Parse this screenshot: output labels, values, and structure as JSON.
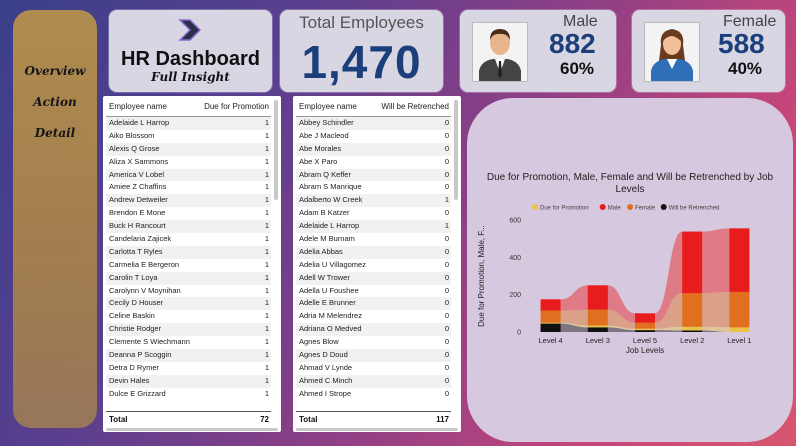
{
  "sidebar": {
    "items": [
      "Overview",
      "Action",
      "Detail"
    ]
  },
  "header": {
    "title": "HR Dashboard",
    "subtitle": "Full Insight"
  },
  "total": {
    "label": "Total Employees",
    "value": "1,470"
  },
  "male": {
    "label": "Male",
    "count": "882",
    "pct": "60%"
  },
  "female": {
    "label": "Female",
    "count": "588",
    "pct": "40%"
  },
  "table1": {
    "headers": [
      "Employee name",
      "Due for Promotion"
    ],
    "rows": [
      [
        "Adelaide L Harrop",
        "1"
      ],
      [
        "Aiko Blossom",
        "1"
      ],
      [
        "Alexis Q Grose",
        "1"
      ],
      [
        "Aliza X Sammons",
        "1"
      ],
      [
        "America V Lobel",
        "1"
      ],
      [
        "Amiee Z Chaffins",
        "1"
      ],
      [
        "Andrew Detweiler",
        "1"
      ],
      [
        "Brendon E Mone",
        "1"
      ],
      [
        "Buck H Rancourt",
        "1"
      ],
      [
        "Candelaria Zajicek",
        "1"
      ],
      [
        "Carlotta T Ryles",
        "1"
      ],
      [
        "Carmelia E Bergeron",
        "1"
      ],
      [
        "Carolin T Loya",
        "1"
      ],
      [
        "Carolynn V Moynihan",
        "1"
      ],
      [
        "Cecily D Houser",
        "1"
      ],
      [
        "Celine Baskin",
        "1"
      ],
      [
        "Christie Rodger",
        "1"
      ],
      [
        "Clemente S Wiechmann",
        "1"
      ],
      [
        "Deanna P Scoggin",
        "1"
      ],
      [
        "Detra D Rymer",
        "1"
      ],
      [
        "Devin Hales",
        "1"
      ],
      [
        "Dulce E Grizzard",
        "1"
      ]
    ],
    "total_label": "Total",
    "total_value": "72"
  },
  "table2": {
    "headers": [
      "Employee name",
      "Will be Retrenched"
    ],
    "rows": [
      [
        "Abbey Schindler",
        "0"
      ],
      [
        "Abe J Macleod",
        "0"
      ],
      [
        "Abe Morales",
        "0"
      ],
      [
        "Abe X Paro",
        "0"
      ],
      [
        "Abram Q Keffer",
        "0"
      ],
      [
        "Abram S Manrique",
        "0"
      ],
      [
        "Adalberto W Creek",
        "1"
      ],
      [
        "Adam B Katzer",
        "0"
      ],
      [
        "Adelaide L Harrop",
        "1"
      ],
      [
        "Adele M Burnam",
        "0"
      ],
      [
        "Adelia Abbas",
        "0"
      ],
      [
        "Adelia U Villagomez",
        "0"
      ],
      [
        "Adell W Trower",
        "0"
      ],
      [
        "Adella U Foushee",
        "0"
      ],
      [
        "Adelle E Brunner",
        "0"
      ],
      [
        "Adria M Melendrez",
        "0"
      ],
      [
        "Adriana O Medved",
        "0"
      ],
      [
        "Agnes Blow",
        "0"
      ],
      [
        "Agnes D Doud",
        "0"
      ],
      [
        "Ahmad V Lynde",
        "0"
      ],
      [
        "Ahmed C Minch",
        "0"
      ],
      [
        "Ahmed I Strope",
        "0"
      ]
    ],
    "total_label": "Total",
    "total_value": "117"
  },
  "chart_data": {
    "type": "area",
    "title": "Due for Promotion, Male, Female and Will be Retrenched by Job Levels",
    "xlabel": "Job Levels",
    "ylabel": "Due for Promotion, Male, F...",
    "categories": [
      "Level 4",
      "Level 3",
      "Level 5",
      "Level 2",
      "Level 1"
    ],
    "ylim": [
      0,
      600
    ],
    "yticks": [
      "0",
      "200",
      "400",
      "600"
    ],
    "series": [
      {
        "name": "Due for Promotion",
        "color": "#e8c24a",
        "values": [
          5,
          10,
          8,
          20,
          25
        ]
      },
      {
        "name": "Male",
        "color": "#e81c1c",
        "values": [
          60,
          130,
          50,
          330,
          340
        ]
      },
      {
        "name": "Female",
        "color": "#e07020",
        "values": [
          65,
          85,
          32,
          180,
          190
        ]
      },
      {
        "name": "Will be Retrenched",
        "color": "#111111",
        "values": [
          45,
          25,
          10,
          8,
          0
        ]
      }
    ],
    "legend_position": "top"
  }
}
